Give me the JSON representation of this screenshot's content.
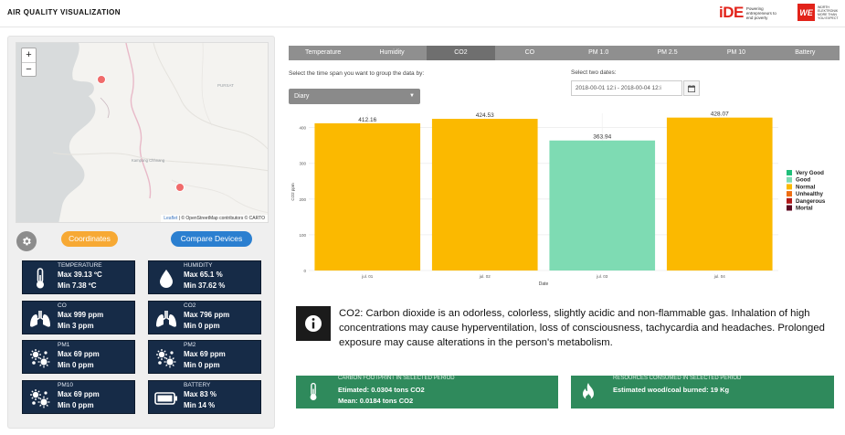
{
  "header": {
    "title": "AIR QUALITY VISUALIZATION"
  },
  "logos": {
    "ide_mark": "iDE",
    "ide_tagline": "Powering entrepreneurs to end poverty",
    "we_mark": "WE",
    "we_tagline": "WÜRTH ELEKTRONIK MORE THAN YOU EXPECT"
  },
  "map": {
    "zoom_in": "+",
    "zoom_out": "−",
    "place_label_1": "PURSAT",
    "place_label_2": "Kampong Chhnang",
    "attribution_leaflet": "Leaflet",
    "attribution_text": "| © OpenStreetMap contributors © CARTO"
  },
  "controls": {
    "coordinates_label": "Coordinates",
    "compare_label": "Compare Devices"
  },
  "cards": [
    {
      "label": "TEMPERATURE",
      "line1": "Max 39.13 ºC",
      "line2": "Min 7.38 ºC",
      "icon": "thermometer-icon"
    },
    {
      "label": "HUMIDITY",
      "line1": "Max 65.1 %",
      "line2": "Min 37.62 %",
      "icon": "water-drop-icon"
    },
    {
      "label": "CO",
      "line1": "Max 999 ppm",
      "line2": "Min 3 ppm",
      "icon": "lungs-icon"
    },
    {
      "label": "CO2",
      "line1": "Max 796 ppm",
      "line2": "Min 0 ppm",
      "icon": "lungs-icon"
    },
    {
      "label": "PM1",
      "line1": "Max 69 ppm",
      "line2": "Min 0 ppm",
      "icon": "particles-icon"
    },
    {
      "label": "PM2",
      "line1": "Max 69 ppm",
      "line2": "Min 0 ppm",
      "icon": "particles-icon"
    },
    {
      "label": "PM10",
      "line1": "Max 69 ppm",
      "line2": "Min 0 ppm",
      "icon": "particles-icon"
    },
    {
      "label": "BATTERY",
      "line1": "Max 83 %",
      "line2": "Min 14 %",
      "icon": "battery-icon"
    }
  ],
  "tabs": [
    {
      "label": "Temperature"
    },
    {
      "label": "Humidity"
    },
    {
      "label": "CO2",
      "active": true
    },
    {
      "label": "CO"
    },
    {
      "label": "PM 1.0"
    },
    {
      "label": "PM 2.5"
    },
    {
      "label": "PM 10"
    },
    {
      "label": "Battery"
    }
  ],
  "filters": {
    "group_label": "Select the time span you want to group the data by:",
    "group_value": "Diary",
    "dates_label": "Select two dates:",
    "date_range": "2018-00-01 12:i  -  2018-00-04 12:i"
  },
  "colors": {
    "very_good": "#1fbf7a",
    "good": "#7edbb3",
    "normal": "#fbb900",
    "unhealthy": "#ee6d12",
    "dangerous": "#b01919",
    "mortal": "#5c0a22"
  },
  "chart_data": {
    "type": "bar",
    "categories": [
      "jul. 01",
      "jul. 02",
      "jul. 03",
      "jul. 04"
    ],
    "values": [
      412.16,
      424.53,
      363.94,
      428.07
    ],
    "value_labels": [
      "412.16",
      "424.53",
      "363.94",
      "428.07"
    ],
    "bar_colors": [
      "#fbb900",
      "#fbb900",
      "#7edbb3",
      "#fbb900"
    ],
    "y_ticks": [
      "0",
      "100",
      "200",
      "300",
      "400"
    ],
    "ylim": [
      0,
      440
    ],
    "xlabel": "Date",
    "ylabel": "CO2 ppm",
    "grid": true,
    "legend_position": "right",
    "legend": [
      {
        "name": "Very Good",
        "color": "#1fbf7a"
      },
      {
        "name": "Good",
        "color": "#7edbb3"
      },
      {
        "name": "Normal",
        "color": "#fbb900"
      },
      {
        "name": "Unhealthy",
        "color": "#ee6d12"
      },
      {
        "name": "Dangerous",
        "color": "#b01919"
      },
      {
        "name": "Mortal",
        "color": "#5c0a22"
      }
    ]
  },
  "info": {
    "text": "CO2: Carbon dioxide is an odorless, colorless, slightly acidic and non-flammable gas. Inhalation of high concentrations may cause hyperventilation, loss of consciousness, tachycardia and headaches. Prolonged exposure may cause alterations in the person's metabolism."
  },
  "footprint": {
    "title": "CARBON FOOTPRINT IN SELECTED PERIOD",
    "line1": "Etimated: 0.0304 tons CO2",
    "line2": "Mean: 0.0184 tons CO2"
  },
  "resources": {
    "title": "RESOURCES CONSUMED IN SELECTED PERIOD",
    "line1": "Estimated wood/coal burned: 19 Kg"
  }
}
